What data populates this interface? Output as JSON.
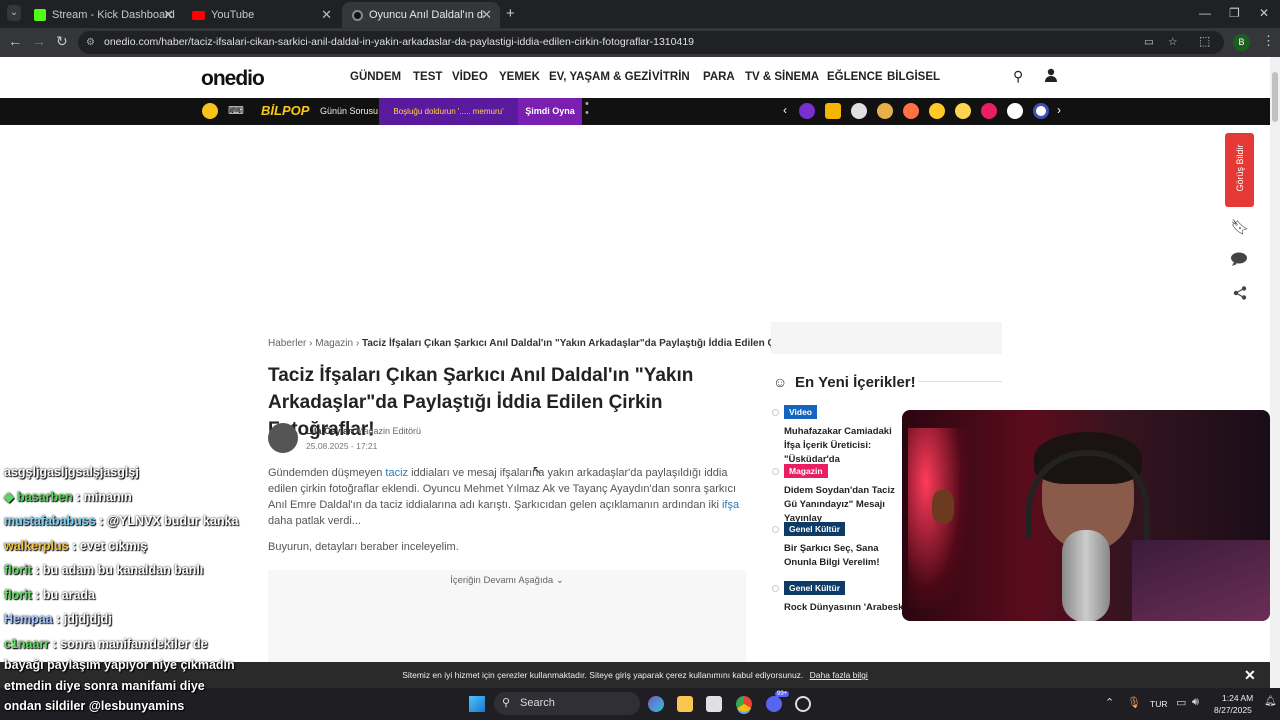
{
  "browser": {
    "tabs": [
      {
        "label": "Stream - Kick Dashboard"
      },
      {
        "label": "YouTube"
      },
      {
        "label": "Oyuncu Anıl Daldal'ın da Adı Ta"
      }
    ],
    "url": "onedio.com/haber/taciz-ifsalari-cikan-sarkici-anil-daldal-in-yakin-arkadaslar-da-paylastigi-iddia-edilen-cirkin-fotograflar-1310419",
    "profile_initial": "B"
  },
  "site": {
    "logo": "onedio",
    "nav": [
      "GÜNDEM",
      "TEST",
      "VİDEO",
      "YEMEK",
      "EV, YAŞAM & GEZİ",
      "VİTRİN",
      "PARA",
      "TV & SİNEMA",
      "EĞLENCE",
      "BİLGİSEL"
    ],
    "promo": {
      "bilpop": "BİLPOP",
      "question_label": "Günün Sorusu",
      "blank_prompt": "Boşluğu doldurun '..... memuru'",
      "play": "Şimdi Oyna"
    },
    "feedback_label": "Görüş Bildir"
  },
  "article": {
    "breadcrumb": [
      "Haberler",
      "Magazin",
      "Taciz İfşaları Çıkan Şarkıcı Anıl Daldal'ın \"Yakın Arkadaşlar\"da Paylaştığı İddia Edilen Çirki..."
    ],
    "title": "Taciz İfşaları Çıkan Şarkıcı Anıl Daldal'ın \"Yakın Arkadaşlar\"da Paylaştığı İddia Edilen Çirkin Fotoğraflar!",
    "author": "Lila Ceylan",
    "author_role": "Magazin Editörü",
    "date": "25.08.2025 - 17:21",
    "intro_parts": [
      "Gündemden düşmeyen ",
      "taciz",
      " iddiaları ve mesaj ifşalarına yakın arkadaşlar'da paylaşıldığı iddia edilen çirkin fotoğraflar eklendi. Oyuncu Mehmet Yılmaz Ak ve Tayanç Ayaydın'dan sonra şarkıcı Anıl Emre Daldal'ın da taciz iddialarına adı karıştı. Şarkıcıdan gelen açıklamanın ardından iki ",
      "ifşa",
      " daha patlak verdi..."
    ],
    "outro": "Buyurun, detayları beraber inceleyelim.",
    "continue_label": "İçeriğin Devamı Aşağıda"
  },
  "sidebar": {
    "heading": "En Yeni İçerikler!",
    "items": [
      {
        "badge": "Video",
        "badge_color": "#1565c0",
        "title": "Muhafazakar Camiadaki İfşa İçerik Üreticisi: \"Üsküdar'da"
      },
      {
        "badge": "Magazin",
        "badge_color": "#e91e63",
        "title": "Didem Soydan'dan Taciz Gü Yanındayız\" Mesajı Yayınlay"
      },
      {
        "badge": "Genel Kültür",
        "badge_color": "#0d3b66",
        "title": "Bir Şarkıcı Seç, Sana Onunla Bilgi Verelim!"
      },
      {
        "badge": "Genel Kültür",
        "badge_color": "#0d3b66",
        "title": "Rock Dünyasının 'Arabesk'i"
      }
    ]
  },
  "chat": [
    {
      "user": "",
      "msg": "asgşljgasljgsalşjasglşj",
      "color": "#ffffff"
    },
    {
      "user": "basarben",
      "msg": ": minanın",
      "color": "#5fd35f"
    },
    {
      "user": "mustafababuss",
      "msg": ": @YLNVX budur kanka",
      "color": "#7fd4f5"
    },
    {
      "user": "walkerplus",
      "msg": ": evet cıkmış",
      "color": "#f4c542"
    },
    {
      "user": "florit",
      "msg": ": bu adam bu kanaldan banlı",
      "color": "#5fe05f"
    },
    {
      "user": "florit",
      "msg": ": bu arada",
      "color": "#5fe05f"
    },
    {
      "user": "Hempaa",
      "msg": ": jdjdjdjdj",
      "color": "#a4c8ff"
    },
    {
      "user": "c1naarr",
      "msg": ": sonra manifamdekiler de",
      "color": "#5fe05f"
    },
    {
      "user": "",
      "msg": "bayağı paylaşım yapıyor niye çıkmadın",
      "color": "#ffffff"
    },
    {
      "user": "",
      "msg": "etmedin diye sonra manifami diye",
      "color": "#ffffff"
    },
    {
      "user": "",
      "msg": "ondan sildiler @lesbunyamins",
      "color": "#ffffff"
    }
  ],
  "cookie": {
    "text": "Sitemiz en iyi hizmet için çerezler kullanmaktadır. Siteye giriş yaparak çerez kullanımını kabul ediyorsunuz.",
    "link": "Daha fazla bilgi"
  },
  "taskbar": {
    "search": "Search",
    "lang": "TUR",
    "time": "1:24 AM",
    "date": "8/27/2025",
    "badge": "99+"
  }
}
